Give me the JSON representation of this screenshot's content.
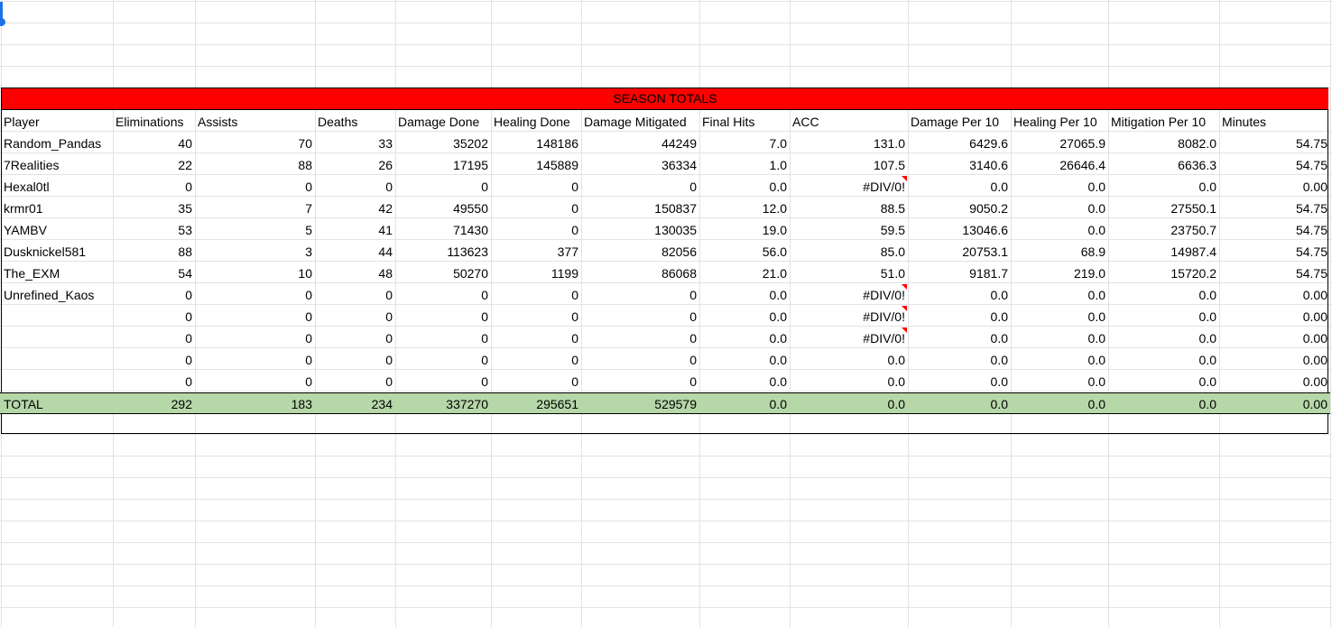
{
  "sheet": {
    "banner_title": "SEASON TOTALS",
    "columns": [
      "Player",
      "Eliminations",
      "Assists",
      "Deaths",
      "Damage Done",
      "Healing Done",
      "Damage Mitigated",
      "Final Hits",
      "ACC",
      "Damage Per 10",
      "Healing Per 10",
      "Mitigation Per 10",
      "Minutes"
    ],
    "rows": [
      [
        "Random_Pandas",
        "40",
        "70",
        "33",
        "35202",
        "148186",
        "44249",
        "7.0",
        "131.0",
        "6429.6",
        "27065.9",
        "8082.0",
        "54.75"
      ],
      [
        "7Realities",
        "22",
        "88",
        "26",
        "17195",
        "145889",
        "36334",
        "1.0",
        "107.5",
        "3140.6",
        "26646.4",
        "6636.3",
        "54.75"
      ],
      [
        "Hexal0tl",
        "0",
        "0",
        "0",
        "0",
        "0",
        "0",
        "0.0",
        "#DIV/0!",
        "0.0",
        "0.0",
        "0.0",
        "0.00"
      ],
      [
        "krmr01",
        "35",
        "7",
        "42",
        "49550",
        "0",
        "150837",
        "12.0",
        "88.5",
        "9050.2",
        "0.0",
        "27550.1",
        "54.75"
      ],
      [
        "YAMBV",
        "53",
        "5",
        "41",
        "71430",
        "0",
        "130035",
        "19.0",
        "59.5",
        "13046.6",
        "0.0",
        "23750.7",
        "54.75"
      ],
      [
        "Dusknickel581",
        "88",
        "3",
        "44",
        "113623",
        "377",
        "82056",
        "56.0",
        "85.0",
        "20753.1",
        "68.9",
        "14987.4",
        "54.75"
      ],
      [
        "The_EXM",
        "54",
        "10",
        "48",
        "50270",
        "1199",
        "86068",
        "21.0",
        "51.0",
        "9181.7",
        "219.0",
        "15720.2",
        "54.75"
      ],
      [
        "Unrefined_Kaos",
        "0",
        "0",
        "0",
        "0",
        "0",
        "0",
        "0.0",
        "#DIV/0!",
        "0.0",
        "0.0",
        "0.0",
        "0.00"
      ],
      [
        "",
        "0",
        "0",
        "0",
        "0",
        "0",
        "0",
        "0.0",
        "#DIV/0!",
        "0.0",
        "0.0",
        "0.0",
        "0.00"
      ],
      [
        "",
        "0",
        "0",
        "0",
        "0",
        "0",
        "0",
        "0.0",
        "#DIV/0!",
        "0.0",
        "0.0",
        "0.0",
        "0.00"
      ],
      [
        "",
        "0",
        "0",
        "0",
        "0",
        "0",
        "0",
        "0.0",
        "0.0",
        "0.0",
        "0.0",
        "0.0",
        "0.00"
      ],
      [
        "",
        "0",
        "0",
        "0",
        "0",
        "0",
        "0",
        "0.0",
        "0.0",
        "0.0",
        "0.0",
        "0.0",
        "0.00"
      ]
    ],
    "total": [
      "TOTAL",
      "292",
      "183",
      "234",
      "337270",
      "295651",
      "529579",
      "0.0",
      "0.0",
      "0.0",
      "0.0",
      "0.0",
      "0.00"
    ],
    "colors": {
      "banner": "#ff0000",
      "total_row": "#b6d7a8",
      "gridline": "#e2e3e3",
      "selection": "#1a73e8",
      "comment_marker": "#ff0000"
    }
  }
}
